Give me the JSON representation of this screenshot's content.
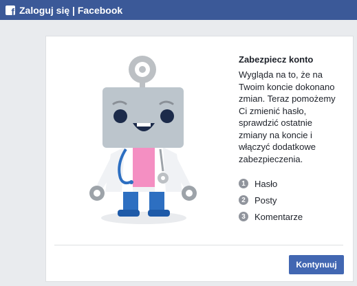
{
  "window": {
    "title": "Zaloguj się | Facebook",
    "logo_letter": "f",
    "accent_color": "#3b5998"
  },
  "main": {
    "heading": "Zabezpiecz konto",
    "description": "Wygląda na to, że na Twoim koncie dokonano zmian. Teraz pomożemy Ci zmienić hasło, sprawdzić ostatnie zmiany na koncie i włączyć dodatkowe zabezpieczenia.",
    "steps": [
      {
        "number": "1",
        "label": "Hasło"
      },
      {
        "number": "2",
        "label": "Posty"
      },
      {
        "number": "3",
        "label": "Komentarze"
      }
    ],
    "continue_label": "Kontynuuj",
    "illustration": "robot-doctor-illustration"
  }
}
